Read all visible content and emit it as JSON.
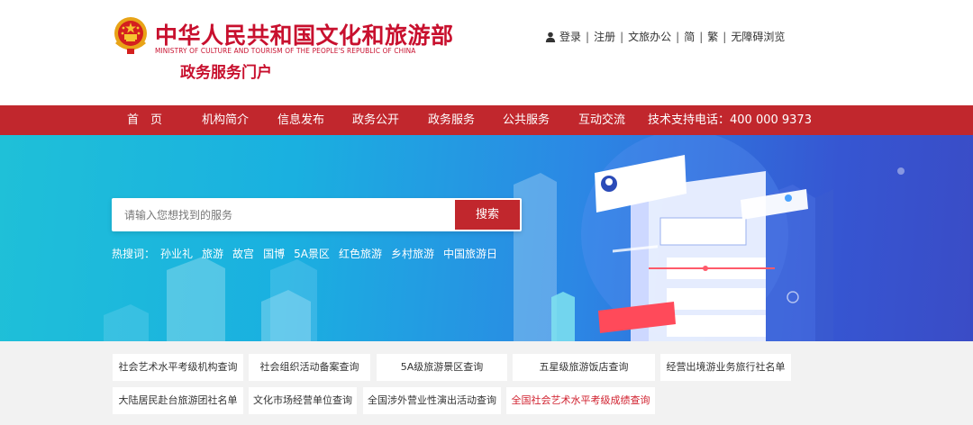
{
  "header": {
    "title_cn": "中华人民共和国文化和旅游部",
    "title_en": "MINISTRY OF CULTURE AND TOURISM OF THE PEOPLE'S REPUBLIC OF CHINA",
    "portal": "政务服务门户",
    "top_links": [
      "登录",
      "注册",
      "文旅办公",
      "简",
      "繁",
      "无障碍浏览"
    ]
  },
  "nav": {
    "items": [
      "首　页",
      "机构简介",
      "信息发布",
      "政务公开",
      "政务服务",
      "公共服务",
      "互动交流"
    ],
    "hotline": "技术支持电话：400 000 9373"
  },
  "search": {
    "placeholder": "请输入您想找到的服务",
    "button": "搜索",
    "hot_label": "热搜词：",
    "hot_words": [
      "孙业礼",
      "旅游",
      "故宫",
      "国博",
      "5A景区",
      "红色旅游",
      "乡村旅游",
      "中国旅游日"
    ]
  },
  "quick_links": {
    "row1": [
      "社会艺术水平考级机构查询",
      "社会组织活动备案查询",
      "5A级旅游景区查询",
      "五星级旅游饭店查询",
      "经营出境游业务旅行社名单"
    ],
    "row2": [
      "大陆居民赴台旅游团社名单",
      "文化市场经营单位查询",
      "全国涉外营业性演出活动查询",
      "全国社会艺术水平考级成绩查询"
    ]
  },
  "colors": {
    "brand_red": "#c1272d",
    "title_red": "#c8102e",
    "banner_start": "#1fc0d8",
    "banner_end": "#3a4cc6"
  },
  "icons": {
    "emblem": "national-emblem",
    "user": "user-icon"
  }
}
